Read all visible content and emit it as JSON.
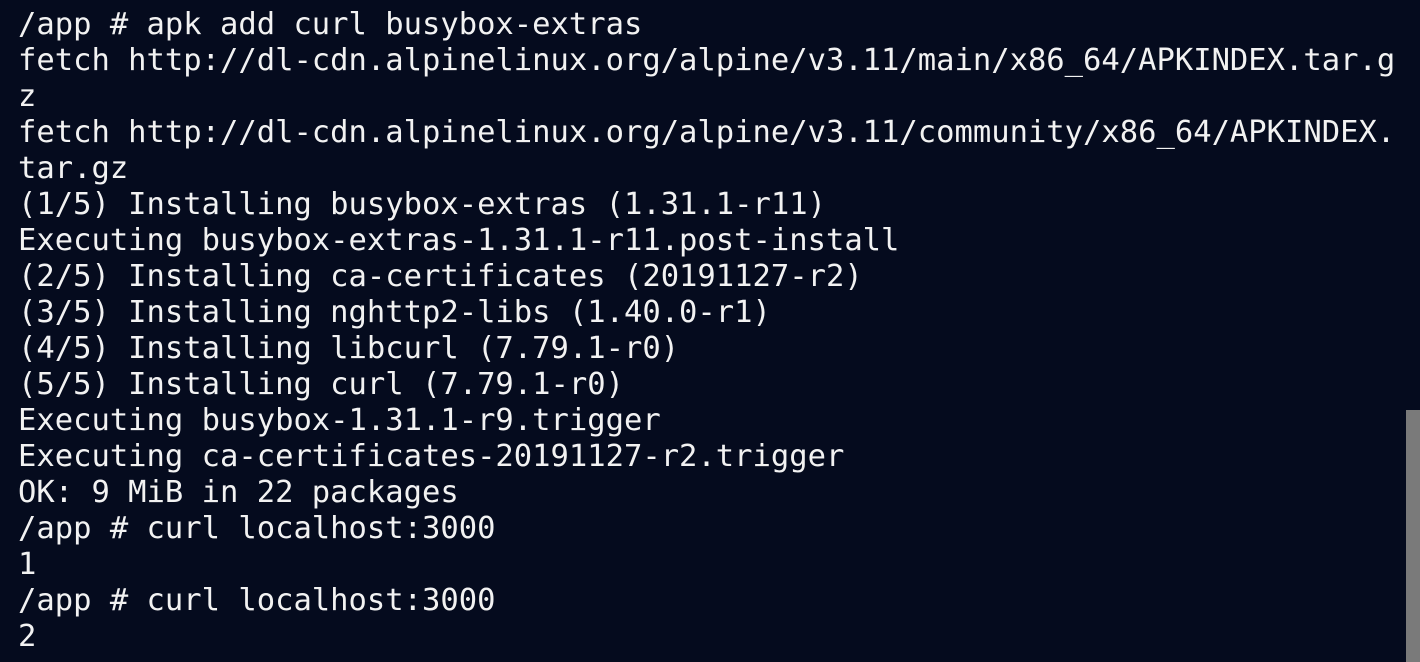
{
  "terminal": {
    "lines": [
      "/app # apk add curl busybox-extras",
      "fetch http://dl-cdn.alpinelinux.org/alpine/v3.11/main/x86_64/APKINDEX.tar.g",
      "z",
      "fetch http://dl-cdn.alpinelinux.org/alpine/v3.11/community/x86_64/APKINDEX.",
      "tar.gz",
      "(1/5) Installing busybox-extras (1.31.1-r11)",
      "Executing busybox-extras-1.31.1-r11.post-install",
      "(2/5) Installing ca-certificates (20191127-r2)",
      "(3/5) Installing nghttp2-libs (1.40.0-r1)",
      "(4/5) Installing libcurl (7.79.1-r0)",
      "(5/5) Installing curl (7.79.1-r0)",
      "Executing busybox-1.31.1-r9.trigger",
      "Executing ca-certificates-20191127-r2.trigger",
      "OK: 9 MiB in 22 packages",
      "/app # curl localhost:3000",
      "1",
      "/app # curl localhost:3000",
      "2"
    ]
  },
  "colors": {
    "background": "#050b1e",
    "foreground": "#f2f2f2",
    "scrollbar": "#7a7a7a"
  }
}
